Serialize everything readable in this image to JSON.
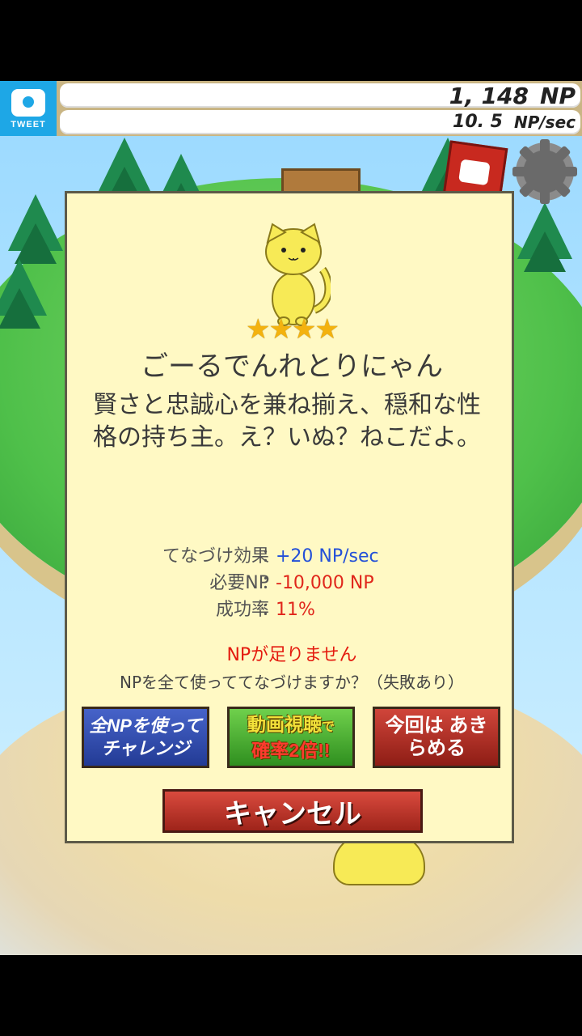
{
  "status": {
    "tweet_label": "TWEET",
    "np_value": "1, 148",
    "np_unit": "NP",
    "rate_value": "10. 5",
    "rate_unit": "NP/sec"
  },
  "modal": {
    "rarity_stars": "★★★★",
    "cat_name": "ごーるでんれとりにゃん",
    "description": "賢さと忠誠心を兼ね揃え、穏和な性格の持ち主。え？いぬ？ねこだよ。",
    "stats": [
      {
        "label": "てなづけ効果",
        "value": "+20 NP/sec",
        "color": "#2350d8"
      },
      {
        "label": "必要NP",
        "value": "-10,000 NP",
        "color": "#e0261b"
      },
      {
        "label": "成功率",
        "value": "11%",
        "color": "#e0261b"
      }
    ],
    "separator": "：",
    "warning": "NPが足りません",
    "confirm_text": "NPを全て使っててなづけますか？（失敗あり）",
    "buttons": {
      "challenge": "全NPを使って チャレンジ",
      "video_line1": "動画視聴",
      "video_suffix": "で",
      "video_line2": "確率2倍!!",
      "give_up": "今回は あきらめる",
      "cancel": "キャンセル"
    }
  },
  "colors": {
    "modal_bg": "#fff9c4",
    "star": "#f3b20f",
    "tweet_blue": "#1ea7e6"
  },
  "icons": [
    "camera-icon",
    "gear-icon",
    "cat-book-icon"
  ]
}
